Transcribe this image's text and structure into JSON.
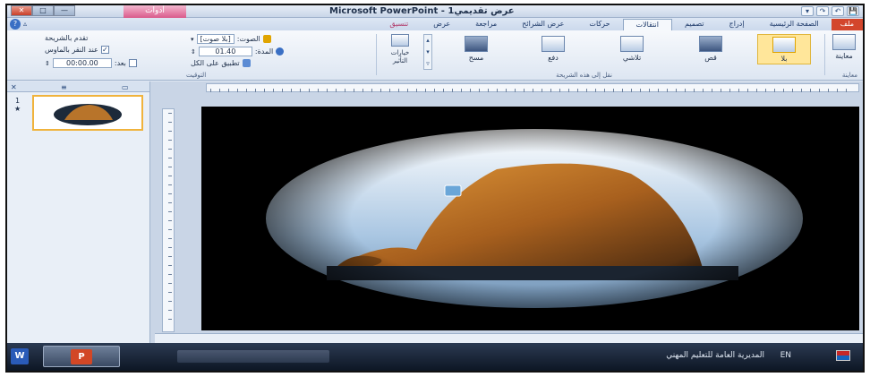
{
  "window": {
    "title": "Microsoft PowerPoint - عرض تقديمي1",
    "context_tab": "أدوات",
    "close_glyph": "✕",
    "max_glyph": "□",
    "min_glyph": "—"
  },
  "quick_access": [
    "💾",
    "↶",
    "↷",
    "▾"
  ],
  "tabs": [
    {
      "label": "ملف",
      "kind": "file"
    },
    {
      "label": "الصفحة الرئيسية",
      "kind": "normal"
    },
    {
      "label": "إدراج",
      "kind": "normal"
    },
    {
      "label": "تصميم",
      "kind": "normal"
    },
    {
      "label": "انتقالات",
      "kind": "active"
    },
    {
      "label": "حركات",
      "kind": "normal"
    },
    {
      "label": "عرض الشرائح",
      "kind": "normal"
    },
    {
      "label": "مراجعة",
      "kind": "normal"
    },
    {
      "label": "عرض",
      "kind": "normal"
    },
    {
      "label": "تنسيق",
      "kind": "ctx"
    }
  ],
  "ribbon": {
    "preview": {
      "label": "معاينة",
      "group": "معاينة"
    },
    "transitions": {
      "group": "نقل إلى هذه الشريحة",
      "items": [
        "بلا",
        "قص",
        "تلاشي",
        "دفع",
        "مسح"
      ],
      "effect_options": "خيارات التأثير"
    },
    "timing": {
      "group": "التوقيت",
      "sound_label": "الصوت:",
      "sound_value": "[بلا صوت]",
      "duration_label": "المدة:",
      "duration_value": "01.40",
      "apply_all": "تطبيق على الكل",
      "advance_label": "تقدم بالشريحة",
      "on_click": "عند النقر بالماوس",
      "after_label": "بعد:",
      "after_value": "00:00.00"
    },
    "colors": {
      "accent": "#f0b33c",
      "file_tab": "#d3462c",
      "context": "#d95a8c"
    }
  },
  "slide_pane": {
    "slide_number": "1"
  },
  "taskbar": {
    "word_icon": "W",
    "ppt_icon": "P",
    "status_text": "المديرية العامة للتعليم المهني",
    "language": "EN"
  }
}
